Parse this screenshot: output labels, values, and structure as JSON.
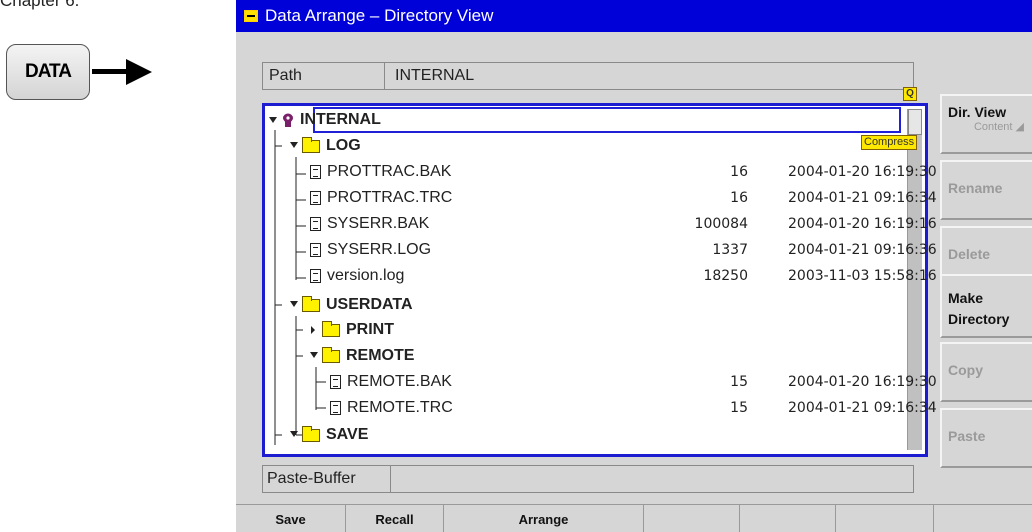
{
  "page": {
    "chapter_text": "Chapter 6."
  },
  "key": {
    "label": "DATA"
  },
  "window": {
    "title": "Data Arrange – Directory View",
    "path_label": "Path",
    "path_value": "INTERNAL",
    "paste_label": "Paste-Buffer",
    "paste_value": "",
    "corner_marker": "Q",
    "compress_badge": "Compress"
  },
  "tree": [
    {
      "name": "INTERNAL",
      "type": "drive",
      "expanded": true
    },
    {
      "name": "LOG",
      "type": "folder",
      "expanded": true
    },
    {
      "name": "PROTTRAC.BAK",
      "type": "file",
      "size": "16",
      "date": "2004-01-20  16:19:30"
    },
    {
      "name": "PROTTRAC.TRC",
      "type": "file",
      "size": "16",
      "date": "2004-01-21  09:16:34"
    },
    {
      "name": "SYSERR.BAK",
      "type": "file",
      "size": "100084",
      "date": "2004-01-20  16:19:16"
    },
    {
      "name": "SYSERR.LOG",
      "type": "file",
      "size": "1337",
      "date": "2004-01-21  09:16:36"
    },
    {
      "name": "version.log",
      "type": "file",
      "size": "18250",
      "date": "2003-11-03  15:58:16"
    },
    {
      "name": "USERDATA",
      "type": "folder",
      "expanded": true
    },
    {
      "name": "PRINT",
      "type": "folder",
      "expanded": false
    },
    {
      "name": "REMOTE",
      "type": "folder",
      "expanded": true
    },
    {
      "name": "REMOTE.BAK",
      "type": "file",
      "size": "15",
      "date": "2004-01-20  16:19:30"
    },
    {
      "name": "REMOTE.TRC",
      "type": "file",
      "size": "15",
      "date": "2004-01-21  09:16:34"
    },
    {
      "name": "SAVE",
      "type": "folder",
      "expanded": true
    }
  ],
  "softkeys": {
    "dir_view": {
      "label": "Dir. View",
      "sub": "Content"
    },
    "rename": {
      "label": "Rename"
    },
    "delete": {
      "label": "Delete"
    },
    "make_directory": {
      "label": "Make Directory"
    },
    "copy": {
      "label": "Copy"
    },
    "paste": {
      "label": "Paste"
    }
  },
  "bottom_tabs": {
    "save": "Save",
    "recall": "Recall",
    "arrange": "Arrange"
  },
  "colors": {
    "title_bar": "#0000d8",
    "selection_frame": "#1c1cd0",
    "folder": "#fff200",
    "marker": "#ffe800"
  }
}
